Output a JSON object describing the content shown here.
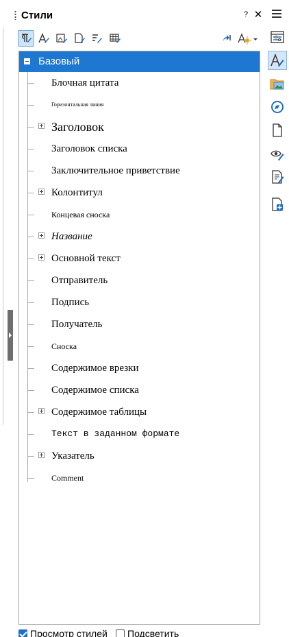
{
  "deck": {
    "title": "Стили",
    "help_label": "?",
    "close_label": "✕"
  },
  "toolbar": {
    "buttons": [
      {
        "icon": "paragraph-styles-icon",
        "active": true
      },
      {
        "icon": "character-styles-icon",
        "active": false
      },
      {
        "icon": "frame-styles-icon",
        "active": false
      },
      {
        "icon": "page-styles-icon",
        "active": false
      },
      {
        "icon": "list-styles-icon",
        "active": false
      },
      {
        "icon": "table-styles-icon",
        "active": false
      },
      {
        "icon": "fill-format-mode-icon",
        "active": false
      },
      {
        "icon": "styles-actions-icon",
        "active": false
      }
    ]
  },
  "tree": {
    "selected": "Базовый",
    "items": [
      {
        "label": "Блочная цитата",
        "expandable": false,
        "style": "normal"
      },
      {
        "label": "Горизонтальная линия",
        "expandable": false,
        "style": "tiny"
      },
      {
        "label": "Заголовок",
        "expandable": true,
        "style": "large"
      },
      {
        "label": "Заголовок списка",
        "expandable": false,
        "style": "normal"
      },
      {
        "label": "Заключительное приветствие",
        "expandable": false,
        "style": "normal"
      },
      {
        "label": "Колонтитул",
        "expandable": true,
        "style": "normal"
      },
      {
        "label": "Концевая сноска",
        "expandable": false,
        "style": "small"
      },
      {
        "label": "Название",
        "expandable": true,
        "style": "italic"
      },
      {
        "label": "Основной текст",
        "expandable": true,
        "style": "normal"
      },
      {
        "label": "Отправитель",
        "expandable": false,
        "style": "normal"
      },
      {
        "label": "Подпись",
        "expandable": false,
        "style": "normal"
      },
      {
        "label": "Получатель",
        "expandable": false,
        "style": "normal"
      },
      {
        "label": "Сноска",
        "expandable": false,
        "style": "small"
      },
      {
        "label": "Содержимое врезки",
        "expandable": false,
        "style": "normal"
      },
      {
        "label": "Содержимое списка",
        "expandable": false,
        "style": "normal"
      },
      {
        "label": "Содержимое таблицы",
        "expandable": true,
        "style": "normal"
      },
      {
        "label": "Текст в заданном формате",
        "expandable": false,
        "style": "mono"
      },
      {
        "label": "Указатель",
        "expandable": true,
        "style": "normal"
      },
      {
        "label": "Comment",
        "expandable": false,
        "style": "small"
      }
    ]
  },
  "bottom": {
    "preview_label": "Просмотр стилей",
    "preview_checked": true,
    "highlight_label": "Подсветить",
    "highlight_checked": false
  },
  "sidebar_tabs": [
    {
      "icon": "properties-icon",
      "active": false
    },
    {
      "icon": "styles-icon",
      "active": true
    },
    {
      "icon": "gallery-icon",
      "active": false
    },
    {
      "icon": "navigator-icon",
      "active": false
    },
    {
      "icon": "page-icon",
      "active": false
    },
    {
      "icon": "style-inspector-icon",
      "active": false
    },
    {
      "icon": "manage-changes-icon",
      "active": false
    },
    {
      "icon": "design-icon",
      "active": false
    }
  ],
  "colors": {
    "selection": "#1e78d2",
    "accent": "#1e6fc8"
  }
}
